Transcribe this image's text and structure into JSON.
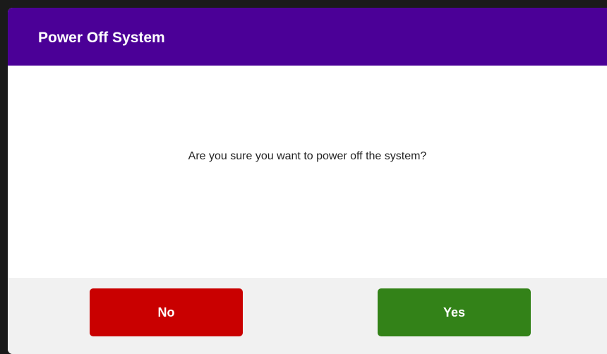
{
  "dialog": {
    "title": "Power Off System",
    "message": "Are you sure you want to power off the system?",
    "buttons": {
      "no_label": "No",
      "yes_label": "Yes"
    }
  },
  "colors": {
    "header": "#4b0097",
    "no_button": "#c90000",
    "yes_button": "#338218",
    "footer": "#f1f1f1"
  }
}
